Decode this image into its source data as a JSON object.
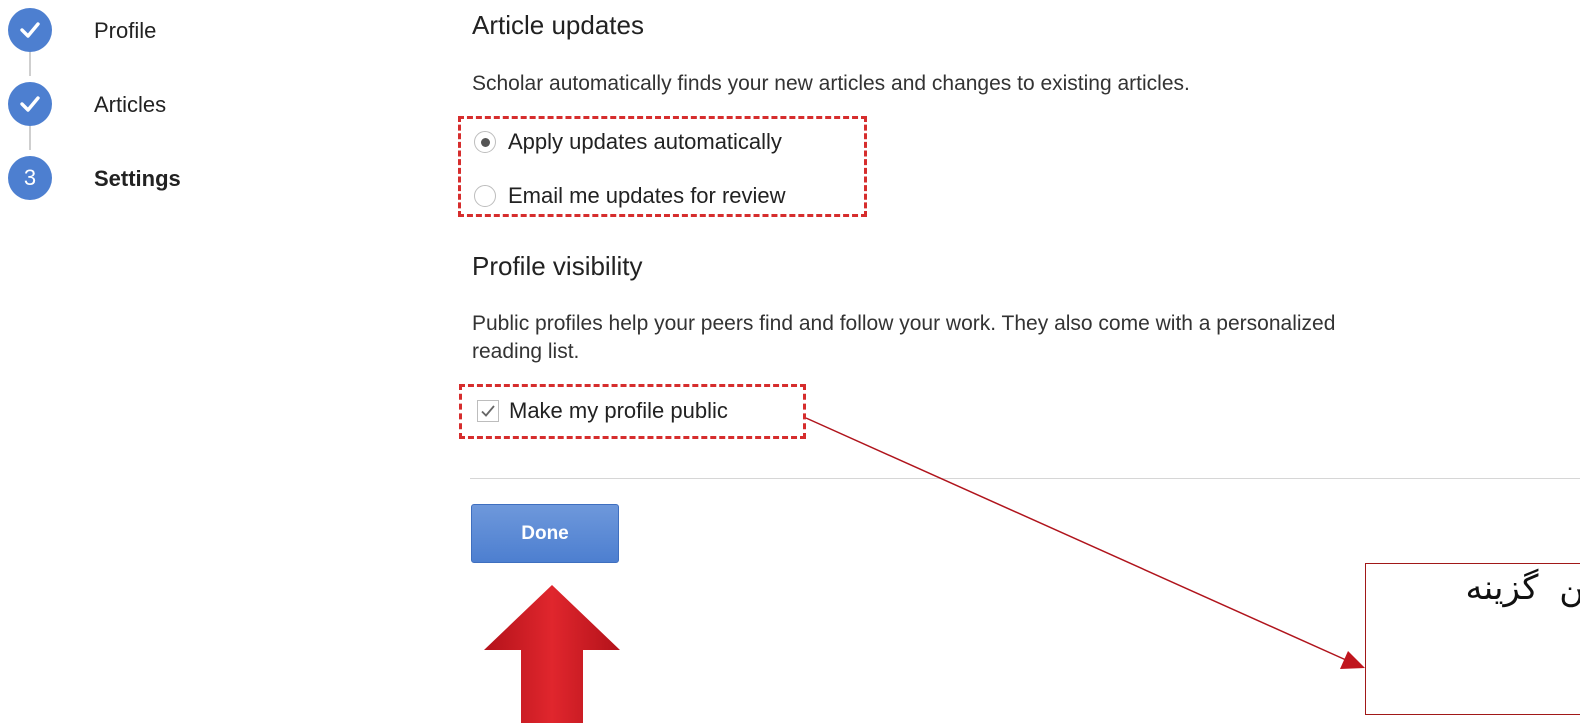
{
  "stepper": {
    "steps": [
      {
        "label": "Profile",
        "state": "complete",
        "icon": "check-icon"
      },
      {
        "label": "Articles",
        "state": "complete",
        "icon": "check-icon"
      },
      {
        "label": "Settings",
        "state": "current",
        "number": "3"
      }
    ],
    "accent_color": "#4d7fd0"
  },
  "article_updates": {
    "title": "Article updates",
    "description": "Scholar automatically finds your new articles and changes to existing articles.",
    "options": [
      {
        "label": "Apply updates automatically",
        "selected": true
      },
      {
        "label": "Email me updates for review",
        "selected": false
      }
    ]
  },
  "profile_visibility": {
    "title": "Profile visibility",
    "description_line1": "Public profiles help your peers find and follow your work. They also come with a personalized",
    "description_line2": "reading list.",
    "checkbox_label": "Make my profile public",
    "checked": true
  },
  "actions": {
    "done_label": "Done",
    "button_color": "#4d7fd0"
  },
  "annotations": {
    "highlight_color": "#d62d2d",
    "arrow_color": "#d11f26",
    "note_text": "این گزینه"
  }
}
